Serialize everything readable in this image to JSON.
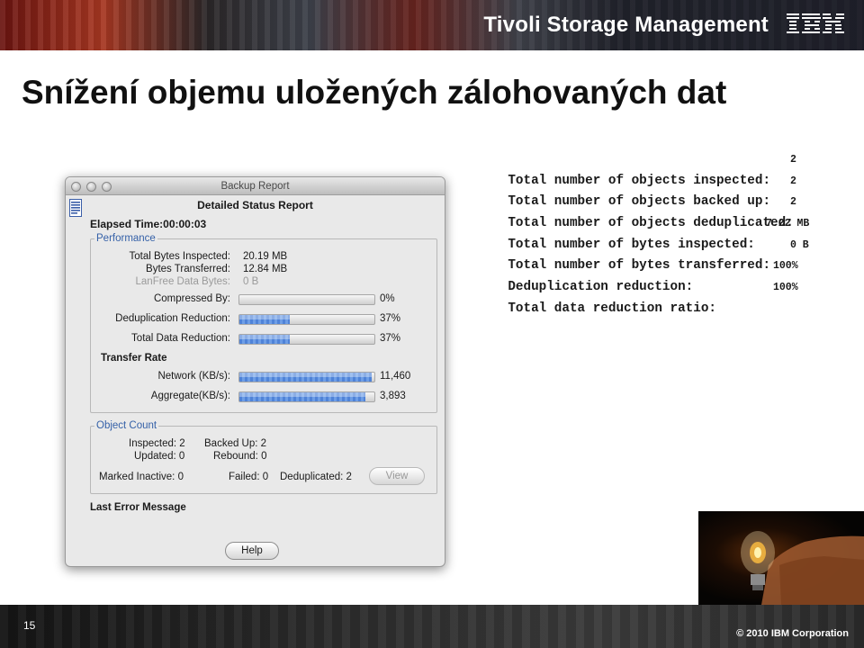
{
  "header": {
    "product": "Tivoli Storage Management",
    "logo": "IBM",
    "slide_title": "Snížení objemu uložených zálohovaných dat"
  },
  "console": {
    "lines": [
      {
        "label": "Total number of objects inspected:",
        "value": "2"
      },
      {
        "label": "Total number of objects backed up:",
        "value": "2"
      },
      {
        "label": "Total number of objects deduplicated:",
        "value": "2"
      },
      {
        "label": "Total number of bytes inspected:",
        "value": "7.22 MB"
      },
      {
        "label": "Total number of bytes transferred:",
        "value": "0 B"
      },
      {
        "label": "Deduplication reduction:",
        "value": "100%"
      },
      {
        "label": "Total data reduction ratio:",
        "value": "100%"
      }
    ]
  },
  "report_window": {
    "title": "Backup Report",
    "heading": "Detailed Status Report",
    "elapsed": "Elapsed Time:00:00:03",
    "performance": {
      "legend": "Performance",
      "total_bytes_inspected": {
        "label": "Total Bytes Inspected:",
        "value": "20.19 MB"
      },
      "bytes_transferred": {
        "label": "Bytes Transferred:",
        "value": "12.84 MB"
      },
      "lanfree_bytes": {
        "label": "LanFree Data Bytes:",
        "value": "0 B"
      },
      "compressed_by": {
        "label": "Compressed By:",
        "value": "0%",
        "fill": 0.0
      },
      "dedup_reduction": {
        "label": "Deduplication Reduction:",
        "value": "37%",
        "fill": 0.37
      },
      "total_data_reduction": {
        "label": "Total Data Reduction:",
        "value": "37%",
        "fill": 0.37
      },
      "transfer_rate_heading": "Transfer Rate",
      "network": {
        "label": "Network (KB/s):",
        "value": "11,460",
        "fill": 0.98
      },
      "aggregate": {
        "label": "Aggregate(KB/s):",
        "value": "3,893",
        "fill": 0.93
      }
    },
    "object_count": {
      "legend": "Object Count",
      "inspected": "Inspected: 2",
      "backed_up": "Backed Up: 2",
      "updated": "Updated: 0",
      "rebound": "Rebound: 0",
      "marked_inactive": "Marked Inactive: 0",
      "failed": "Failed: 0",
      "deduplicated": "Deduplicated: 2",
      "view_button": "View"
    },
    "last_error_label": "Last Error Message",
    "help_button": "Help"
  },
  "footer": {
    "page_number": "15",
    "copyright": "© 2010 IBM Corporation"
  }
}
